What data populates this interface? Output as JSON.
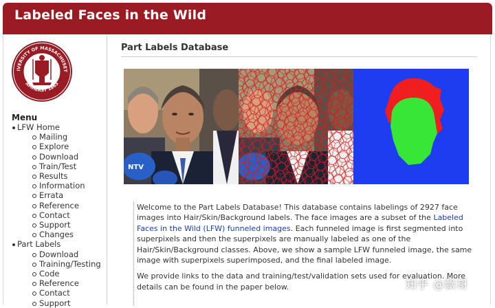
{
  "header": {
    "title": "Labeled Faces in the Wild"
  },
  "sidebar": {
    "logo": {
      "ring_text_top": "UNIVERSITY OF MASSACHUSETTS",
      "ring_text_bottom": "AMHERST 1863"
    },
    "menu_title": "Menu",
    "items": [
      {
        "label": "LFW Home",
        "level": 1
      },
      {
        "label": "Mailing",
        "level": 2
      },
      {
        "label": "Explore",
        "level": 2
      },
      {
        "label": "Download",
        "level": 2
      },
      {
        "label": "Train/Test",
        "level": 2
      },
      {
        "label": "Results",
        "level": 2
      },
      {
        "label": "Information",
        "level": 2
      },
      {
        "label": "Errata",
        "level": 2
      },
      {
        "label": "Reference",
        "level": 2
      },
      {
        "label": "Contact",
        "level": 2
      },
      {
        "label": "Support",
        "level": 2
      },
      {
        "label": "Changes",
        "level": 2
      },
      {
        "label": "Part Labels",
        "level": 1
      },
      {
        "label": "Download",
        "level": 2
      },
      {
        "label": "Training/Testing",
        "level": 2
      },
      {
        "label": "Code",
        "level": 2
      },
      {
        "label": "Reference",
        "level": 2
      },
      {
        "label": "Contact",
        "level": 2
      },
      {
        "label": "Support",
        "level": 2
      }
    ]
  },
  "main": {
    "title": "Part Labels Database",
    "banner": {
      "mic_text": "NTV"
    },
    "paragraph1_before": "Welcome to the Part Labels Database! This database contains labelings of 2927 face images into Hair/Skin/Background labels. The face images are a subset of the ",
    "paragraph1_link": "Labeled Faces in the Wild (LFW) funneled images",
    "paragraph1_after": ". Each funneled image is first segmented into superpixels and then the superpixels are manually labeled as one of the Hair/Skin/Background classes. Above, we show a sample LFW funneled image, the same image with superpixels superimposed, and the final labeled image.",
    "paragraph2": "We provide links to the data and training/test/validation sets used for evaluation. More details can be found in the paper below."
  },
  "watermark": "知乎 @飘哥",
  "colors": {
    "header_bg": "#9b1b24",
    "link": "#1a3fa8",
    "label_background": "#1e3cf0",
    "label_hair": "#f01e1e",
    "label_skin": "#37e637",
    "superpixel_lines": "#d42020"
  }
}
